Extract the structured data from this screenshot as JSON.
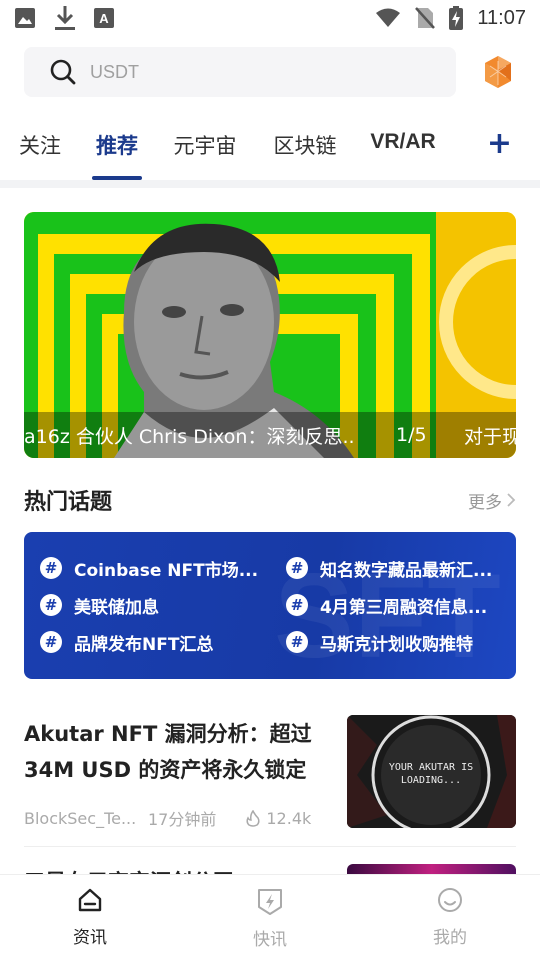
{
  "status_bar": {
    "time": "11:07"
  },
  "search": {
    "placeholder": "USDT"
  },
  "tabs": [
    {
      "label": "关注"
    },
    {
      "label": "推荐"
    },
    {
      "label": "元宇宙"
    },
    {
      "label": "区块链"
    },
    {
      "label": "VR/AR"
    }
  ],
  "banner": {
    "title": "a16z 合伙人 Chris Dixon：深刻反思..",
    "page": "1/5",
    "next_title": "对于现"
  },
  "hot_topics": {
    "title": "热门话题",
    "more": "更多",
    "items": [
      {
        "label": "Coinbase NFT市场..."
      },
      {
        "label": "知名数字藏品最新汇..."
      },
      {
        "label": "美联储加息"
      },
      {
        "label": "4月第三周融资信息..."
      },
      {
        "label": "品牌发布NFT汇总"
      },
      {
        "label": "马斯克计划收购推特"
      }
    ]
  },
  "article": {
    "title": "Akutar NFT 漏洞分析：超过 34M USD 的资产将永久锁定",
    "author": "BlockSec_Te...",
    "time": "17分钟前",
    "views": "12.4k",
    "thumb_text": "YOUR AKUTAR IS LOADING..."
  },
  "next_article": {
    "title": "三星在元宇宙汇创公司"
  },
  "bottom_nav": [
    {
      "label": "资讯"
    },
    {
      "label": "快讯"
    },
    {
      "label": "我的"
    }
  ],
  "colors": {
    "accent": "#1b3a8c",
    "topics_bg": "#173aa6",
    "banner_yellow": "#ffe100",
    "banner_green": "#19c21a"
  }
}
